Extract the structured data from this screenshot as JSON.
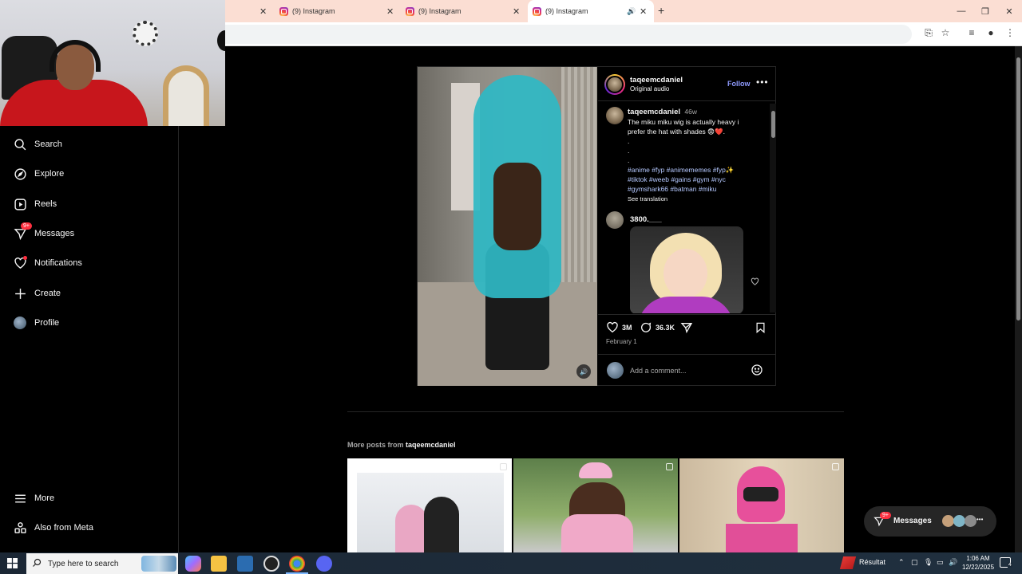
{
  "browser": {
    "tabs": [
      {
        "title": "",
        "close": "✕"
      },
      {
        "title": "(9) Instagram",
        "close": "✕"
      },
      {
        "title": "(9) Instagram",
        "close": "✕"
      },
      {
        "title": "(9) Instagram",
        "close": "✕",
        "audio": "🔊",
        "active": true
      }
    ],
    "new_tab": "+",
    "window_controls": {
      "minimize": "—",
      "maximize": "❐",
      "close": "✕"
    }
  },
  "sidebar": {
    "items": [
      {
        "label": "Search",
        "icon": "search-icon"
      },
      {
        "label": "Explore",
        "icon": "compass-icon"
      },
      {
        "label": "Reels",
        "icon": "reels-icon"
      },
      {
        "label": "Messages",
        "icon": "messenger-icon",
        "badge": "9+"
      },
      {
        "label": "Notifications",
        "icon": "heart-icon",
        "dot": true
      },
      {
        "label": "Create",
        "icon": "plus-icon"
      },
      {
        "label": "Profile",
        "icon": "avatar"
      }
    ],
    "bottom": [
      {
        "label": "More",
        "icon": "menu-icon"
      },
      {
        "label": "Also from Meta",
        "icon": "meta-apps-icon"
      }
    ]
  },
  "post": {
    "author": "taqeemcdaniel",
    "audio": "Original audio",
    "follow_label": "Follow",
    "more_label": "•••",
    "caption": {
      "username": "taqeemcdaniel",
      "age": "46w",
      "text": "The miku miku wig is actually heavy i prefer the hat with shades 😨❤️.",
      "dots": [
        ".",
        ".",
        "."
      ],
      "hashtags": "#anime #fyp #animememes #fyp✨ #tiktok #weeb #gains #gym #nyc #gymshark66 #batman #miku",
      "see_translation": "See translation"
    },
    "comment": {
      "username": "3800.___"
    },
    "likes": "3M",
    "comments_count": "36.3K",
    "date": "February 1",
    "add_comment_placeholder": "Add a comment...",
    "colors": {
      "follow": "#8f9bff",
      "badge": "#ff3040"
    }
  },
  "more_posts": {
    "prefix": "More posts from ",
    "username": "taqeemcdaniel"
  },
  "messages_pill": {
    "label": "Messages",
    "badge": "9+",
    "more": "•••"
  },
  "taskbar": {
    "search_placeholder": "Type here to search",
    "weather_label": "Résultat",
    "time": "1:06 AM",
    "date": "12/22/2025",
    "notification_count": "4"
  }
}
